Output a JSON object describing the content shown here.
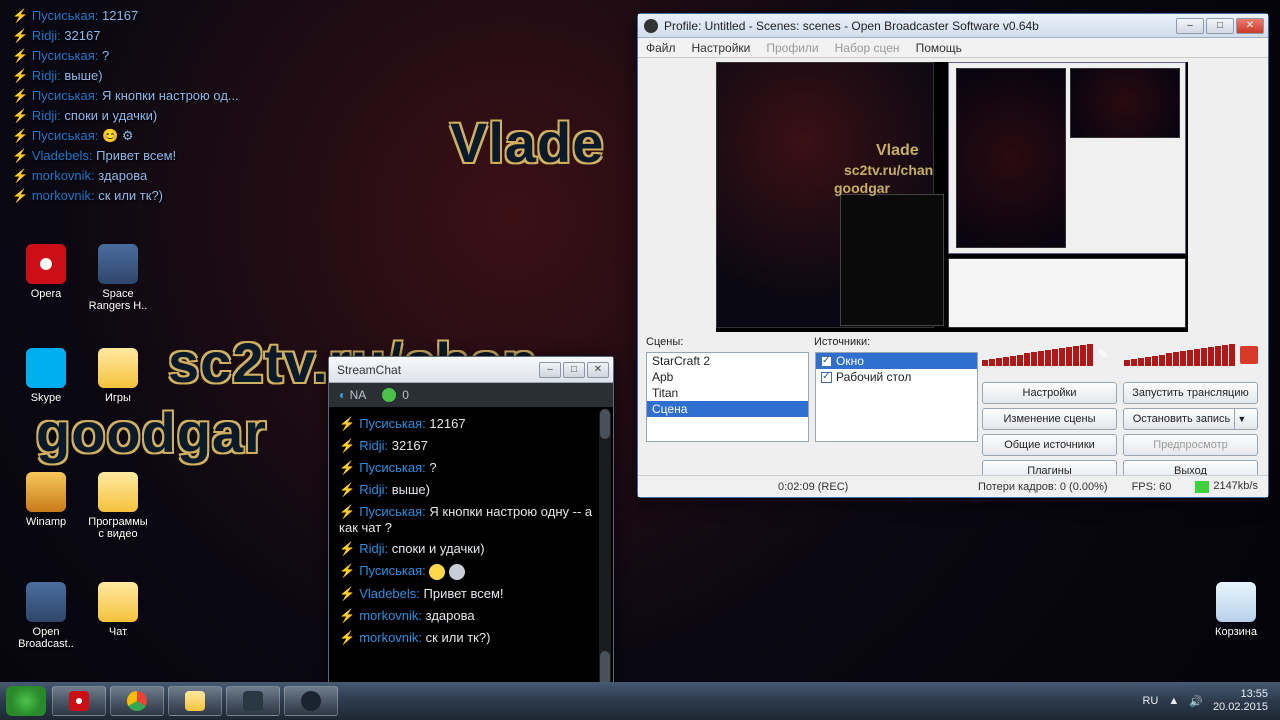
{
  "overlay": {
    "l1": "Vlade",
    "l2": "sc2tv.ru/chan",
    "l3": "goodgar"
  },
  "desktop": {
    "opera": "Opera",
    "space": "Space Rangers H..",
    "skype": "Skype",
    "igry": "Игры",
    "winamp": "Winamp",
    "progs": "Программы с видео",
    "obs": "Open Broadcast..",
    "chat": "Чат",
    "trash": "Корзина"
  },
  "bgchat": [
    {
      "n": "Пусиськая",
      "t": "12167"
    },
    {
      "n": "Ridji",
      "t": "32167"
    },
    {
      "n": "Пусиськая",
      "t": "?"
    },
    {
      "n": "Ridji",
      "t": "выше)"
    },
    {
      "n": "Пусиськая",
      "t": "Я кнопки настрою од..."
    },
    {
      "n": "Ridji",
      "t": "споки и удачки)"
    },
    {
      "n": "Пусиськая",
      "t": "😊 ⚙"
    },
    {
      "n": "Vladebels",
      "t": "Привет всем!"
    },
    {
      "n": "morkovnik",
      "t": "здарова"
    },
    {
      "n": "morkovnik",
      "t": "ск или тк?)"
    }
  ],
  "chatwin": {
    "title": "StreamChat",
    "status": {
      "na": "NA",
      "count": "0"
    },
    "msgs": [
      {
        "u": "Пусиськая",
        "t": "12167"
      },
      {
        "u": "Ridji",
        "t": "32167"
      },
      {
        "u": "Пусиськая",
        "t": "?"
      },
      {
        "u": "Ridji",
        "t": "выше)"
      },
      {
        "u": "Пусиськая",
        "t": "Я кнопки настрою одну -- а как чат ?"
      },
      {
        "u": "Ridji",
        "t": "споки и удачки)"
      },
      {
        "u": "Пусиськая",
        "t": ""
      },
      {
        "u": "Vladebels",
        "t": "Привет всем!"
      },
      {
        "u": "morkovnik",
        "t": "здарова"
      },
      {
        "u": "morkovnik",
        "t": "ск или тк?)"
      }
    ]
  },
  "obs": {
    "title": "Profile: Untitled - Scenes: scenes - Open Broadcaster Software v0.64b",
    "menu": {
      "file": "Файл",
      "settings": "Настройки",
      "profiles": "Профили",
      "scenes": "Набор сцен",
      "help": "Помощь"
    },
    "labels": {
      "scenes": "Сцены:",
      "sources": "Источники:"
    },
    "scenes": [
      "StarCraft 2",
      "Apb",
      "Titan",
      "Сцена"
    ],
    "sources": [
      {
        "n": "Окно",
        "sel": true
      },
      {
        "n": "Рабочий стол",
        "sel": false
      }
    ],
    "buttons": {
      "settings": "Настройки",
      "start": "Запустить трансляцию",
      "edit": "Изменение сцены",
      "stop": "Остановить запись",
      "global": "Общие источники",
      "preview": "Предпросмотр",
      "plugins": "Плагины",
      "exit": "Выход"
    },
    "status": {
      "rec": "0:02:09 (REC)",
      "drop": "Потери кадров: 0 (0.00%)",
      "fps": "FPS: 60",
      "bw": "2147kb/s"
    }
  },
  "taskbar": {
    "lang": "RU",
    "time": "13:55",
    "date": "20.02.2015"
  }
}
